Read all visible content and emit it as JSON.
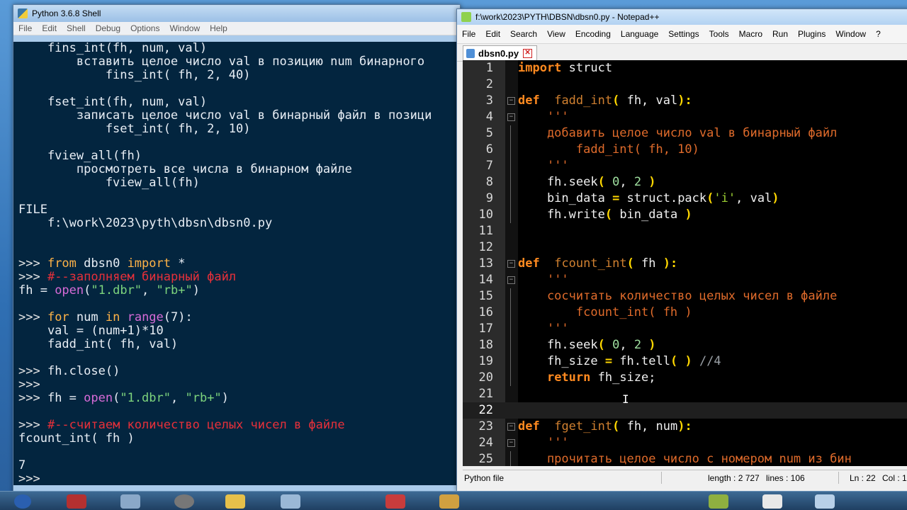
{
  "shell": {
    "title": "Python 3.6.8 Shell",
    "menu": [
      "File",
      "Edit",
      "Shell",
      "Debug",
      "Options",
      "Window",
      "Help"
    ],
    "lines": [
      [
        {
          "t": "    fins_int(fh, num, val)",
          "c": "out"
        }
      ],
      [
        {
          "t": "        вставить целое число val в позицию num бинарного",
          "c": "out"
        }
      ],
      [
        {
          "t": "            fins_int( fh, 2, 40)",
          "c": "out"
        }
      ],
      [
        {
          "t": "",
          "c": "out"
        }
      ],
      [
        {
          "t": "    fset_int(fh, num, val)",
          "c": "out"
        }
      ],
      [
        {
          "t": "        записать целое число val в бинарный файл в позици",
          "c": "out"
        }
      ],
      [
        {
          "t": "            fset_int( fh, 2, 10)",
          "c": "out"
        }
      ],
      [
        {
          "t": "",
          "c": "out"
        }
      ],
      [
        {
          "t": "    fview_all(fh)",
          "c": "out"
        }
      ],
      [
        {
          "t": "        просмотреть все числа в бинарном файле",
          "c": "out"
        }
      ],
      [
        {
          "t": "            fview_all(fh)",
          "c": "out"
        }
      ],
      [
        {
          "t": "",
          "c": "out"
        }
      ],
      [
        {
          "t": "FILE",
          "c": "out"
        }
      ],
      [
        {
          "t": "    f:\\work\\2023\\pyth\\dbsn\\dbsn0.py",
          "c": "out"
        }
      ],
      [
        {
          "t": "",
          "c": "out"
        }
      ],
      [
        {
          "t": "",
          "c": "out"
        }
      ],
      [
        {
          "t": ">>> ",
          "c": "prompt"
        },
        {
          "t": "from",
          "c": "kw"
        },
        {
          "t": " dbsn0 ",
          "c": "out"
        },
        {
          "t": "import",
          "c": "kw"
        },
        {
          "t": " *",
          "c": "out"
        }
      ],
      [
        {
          "t": ">>> ",
          "c": "prompt"
        },
        {
          "t": "#--заполняем бинарный файл",
          "c": "cmt"
        }
      ],
      [
        {
          "t": "fh = ",
          "c": "out"
        },
        {
          "t": "open",
          "c": "bi"
        },
        {
          "t": "(",
          "c": "out"
        },
        {
          "t": "\"1.dbr\"",
          "c": "str"
        },
        {
          "t": ", ",
          "c": "out"
        },
        {
          "t": "\"rb+\"",
          "c": "str"
        },
        {
          "t": ")",
          "c": "out"
        }
      ],
      [
        {
          "t": "",
          "c": "out"
        }
      ],
      [
        {
          "t": ">>> ",
          "c": "prompt"
        },
        {
          "t": "for",
          "c": "kw"
        },
        {
          "t": " num ",
          "c": "out"
        },
        {
          "t": "in",
          "c": "kw"
        },
        {
          "t": " ",
          "c": "out"
        },
        {
          "t": "range",
          "c": "bi"
        },
        {
          "t": "(7):",
          "c": "out"
        }
      ],
      [
        {
          "t": "    val = (num+1)*10",
          "c": "out"
        }
      ],
      [
        {
          "t": "    fadd_int( fh, val)",
          "c": "out"
        }
      ],
      [
        {
          "t": "",
          "c": "out"
        }
      ],
      [
        {
          "t": ">>> ",
          "c": "prompt"
        },
        {
          "t": "fh.close()",
          "c": "out"
        }
      ],
      [
        {
          "t": ">>> ",
          "c": "prompt"
        }
      ],
      [
        {
          "t": ">>> ",
          "c": "prompt"
        },
        {
          "t": "fh = ",
          "c": "out"
        },
        {
          "t": "open",
          "c": "bi"
        },
        {
          "t": "(",
          "c": "out"
        },
        {
          "t": "\"1.dbr\"",
          "c": "str"
        },
        {
          "t": ", ",
          "c": "out"
        },
        {
          "t": "\"rb+\"",
          "c": "str"
        },
        {
          "t": ")",
          "c": "out"
        }
      ],
      [
        {
          "t": "",
          "c": "out"
        }
      ],
      [
        {
          "t": ">>> ",
          "c": "prompt"
        },
        {
          "t": "#--считаем количество целых чисел в файле",
          "c": "cmt"
        }
      ],
      [
        {
          "t": "fcount_int( fh )",
          "c": "out"
        }
      ],
      [
        {
          "t": "",
          "c": "out"
        }
      ],
      [
        {
          "t": "7",
          "c": "out"
        }
      ],
      [
        {
          "t": ">>> ",
          "c": "prompt"
        }
      ]
    ]
  },
  "npp": {
    "title": "f:\\work\\2023\\PYTH\\DBSN\\dbsn0.py - Notepad++",
    "menu": [
      "File",
      "Edit",
      "Search",
      "View",
      "Encoding",
      "Language",
      "Settings",
      "Tools",
      "Macro",
      "Run",
      "Plugins",
      "Window",
      "?"
    ],
    "tab": "dbsn0.py",
    "current_line": 22,
    "code": [
      {
        "n": "1",
        "fold": "",
        "p": [
          {
            "t": "import",
            "c": "k"
          },
          {
            "t": " struct",
            "c": ""
          }
        ]
      },
      {
        "n": "2",
        "fold": "",
        "p": []
      },
      {
        "n": "3",
        "fold": "box",
        "p": [
          {
            "t": "def",
            "c": "k"
          },
          {
            "t": "  ",
            "c": ""
          },
          {
            "t": "fadd_int",
            "c": "fn"
          },
          {
            "t": "(",
            "c": "op"
          },
          {
            "t": " fh, val",
            "c": ""
          },
          {
            "t": "):",
            "c": "op"
          }
        ]
      },
      {
        "n": "4",
        "fold": "box",
        "p": [
          {
            "t": "    ",
            "c": ""
          },
          {
            "t": "'''",
            "c": "cm"
          }
        ]
      },
      {
        "n": "5",
        "fold": "line",
        "p": [
          {
            "t": "    добавить целое число val в бинарный файл",
            "c": "cm"
          }
        ]
      },
      {
        "n": "6",
        "fold": "line",
        "p": [
          {
            "t": "        fadd_int( fh, 10)",
            "c": "cm"
          }
        ]
      },
      {
        "n": "7",
        "fold": "line",
        "p": [
          {
            "t": "    ",
            "c": ""
          },
          {
            "t": "'''",
            "c": "cm"
          }
        ]
      },
      {
        "n": "8",
        "fold": "line",
        "p": [
          {
            "t": "    fh.seek",
            "c": ""
          },
          {
            "t": "(",
            "c": "op"
          },
          {
            "t": " 0",
            "c": "num"
          },
          {
            "t": ", ",
            "c": ""
          },
          {
            "t": "2",
            "c": "num"
          },
          {
            "t": " )",
            "c": "op"
          }
        ]
      },
      {
        "n": "9",
        "fold": "line",
        "p": [
          {
            "t": "    bin_data ",
            "c": ""
          },
          {
            "t": "=",
            "c": "op"
          },
          {
            "t": " struct.pack",
            "c": ""
          },
          {
            "t": "(",
            "c": "op"
          },
          {
            "t": "'i'",
            "c": "s"
          },
          {
            "t": ", val",
            "c": ""
          },
          {
            "t": ")",
            "c": "op"
          }
        ]
      },
      {
        "n": "10",
        "fold": "line",
        "p": [
          {
            "t": "    fh.write",
            "c": ""
          },
          {
            "t": "(",
            "c": "op"
          },
          {
            "t": " bin_data ",
            "c": ""
          },
          {
            "t": ")",
            "c": "op"
          }
        ]
      },
      {
        "n": "11",
        "fold": "",
        "p": []
      },
      {
        "n": "12",
        "fold": "",
        "p": []
      },
      {
        "n": "13",
        "fold": "box",
        "p": [
          {
            "t": "def",
            "c": "k"
          },
          {
            "t": "  ",
            "c": ""
          },
          {
            "t": "fcount_int",
            "c": "fn"
          },
          {
            "t": "(",
            "c": "op"
          },
          {
            "t": " fh ",
            "c": ""
          },
          {
            "t": "):",
            "c": "op"
          }
        ]
      },
      {
        "n": "14",
        "fold": "box",
        "p": [
          {
            "t": "    ",
            "c": ""
          },
          {
            "t": "'''",
            "c": "cm"
          }
        ]
      },
      {
        "n": "15",
        "fold": "line",
        "p": [
          {
            "t": "    сосчитать количество целых чисел в файле",
            "c": "cm"
          }
        ]
      },
      {
        "n": "16",
        "fold": "line",
        "p": [
          {
            "t": "        fcount_int( fh )",
            "c": "cm"
          }
        ]
      },
      {
        "n": "17",
        "fold": "line",
        "p": [
          {
            "t": "    ",
            "c": ""
          },
          {
            "t": "'''",
            "c": "cm"
          }
        ]
      },
      {
        "n": "18",
        "fold": "line",
        "p": [
          {
            "t": "    fh.seek",
            "c": ""
          },
          {
            "t": "(",
            "c": "op"
          },
          {
            "t": " 0",
            "c": "num"
          },
          {
            "t": ", ",
            "c": ""
          },
          {
            "t": "2",
            "c": "num"
          },
          {
            "t": " )",
            "c": "op"
          }
        ]
      },
      {
        "n": "19",
        "fold": "line",
        "p": [
          {
            "t": "    fh_size ",
            "c": ""
          },
          {
            "t": "=",
            "c": "op"
          },
          {
            "t": " fh.tell",
            "c": ""
          },
          {
            "t": "(",
            "c": "op"
          },
          {
            "t": " ",
            "c": ""
          },
          {
            "t": ")",
            "c": "op"
          },
          {
            "t": " //4",
            "c": "cc"
          }
        ]
      },
      {
        "n": "20",
        "fold": "line",
        "p": [
          {
            "t": "    ",
            "c": ""
          },
          {
            "t": "return",
            "c": "k"
          },
          {
            "t": " fh_size;",
            "c": ""
          }
        ]
      },
      {
        "n": "21",
        "fold": "",
        "p": []
      },
      {
        "n": "22",
        "fold": "",
        "p": []
      },
      {
        "n": "23",
        "fold": "box",
        "p": [
          {
            "t": "def",
            "c": "k"
          },
          {
            "t": "  ",
            "c": ""
          },
          {
            "t": "fget_int",
            "c": "fn"
          },
          {
            "t": "(",
            "c": "op"
          },
          {
            "t": " fh, num",
            "c": ""
          },
          {
            "t": "):",
            "c": "op"
          }
        ]
      },
      {
        "n": "24",
        "fold": "box",
        "p": [
          {
            "t": "    ",
            "c": ""
          },
          {
            "t": "'''",
            "c": "cm"
          }
        ]
      },
      {
        "n": "25",
        "fold": "line",
        "p": [
          {
            "t": "    прочитать целое число с номером num из бин",
            "c": "cm"
          }
        ]
      }
    ],
    "status": {
      "type": "Python file",
      "length": "length : 2 727",
      "lines": "lines : 106",
      "ln": "Ln : 22",
      "col": "Col : 1"
    }
  }
}
